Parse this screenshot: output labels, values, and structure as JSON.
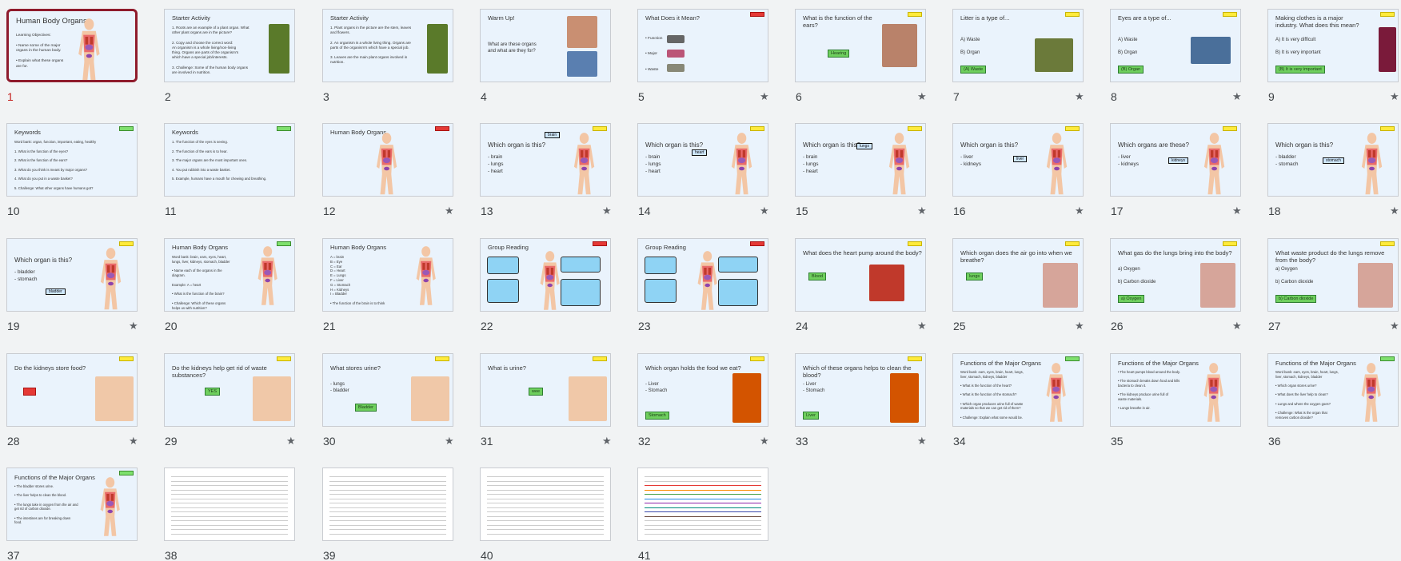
{
  "slides": [
    {
      "n": "1",
      "title": "Human Body Organs",
      "text": "Learning Objectives:\n\n• Name some of the major\n  organs in the human body.\n\n• Explain what these organs\n  are for.",
      "star": false,
      "selected": true
    },
    {
      "n": "2",
      "title": "Starter Activity",
      "text": "1. Roots are an example of a plant organ. What\n    other plant organs are in the picture?\n\n2. Copy and choose the correct word:\n    An organism is a whole living/non-living\n    thing. Organs are parts of the organism's\n    which have a special job/interests.\n\n3. Challenge: Some of the human body organs\n    are involved in nutrition.",
      "star": false
    },
    {
      "n": "3",
      "title": "Starter Activity",
      "text": "1. Plant organs in the picture are the stem, leaves\n    and flowers.\n\n2. An organism is a whole living thing. Organs are\n    parts of the organism's which have a special job.\n\n3. Leaves are the main plant organs involved in\n    nutrition.",
      "star": false
    },
    {
      "n": "4",
      "title": "Warm Up!",
      "text": "What are these organs\nand what are they for?",
      "star": false
    },
    {
      "n": "5",
      "title": "What Does it Mean?",
      "text": "• Function\n\n\n• Major\n\n\n• Waste",
      "star": true
    },
    {
      "n": "6",
      "title": "What is the function of the\nears?",
      "btn": "Hearing",
      "star": true
    },
    {
      "n": "7",
      "title": "Litter is a type of...",
      "text": "A)  Waste\n\nB)  Organ",
      "btn": "(A) Waste",
      "star": true
    },
    {
      "n": "8",
      "title": "Eyes are a type of...",
      "text": "A)  Waste\n\nB)  Organ",
      "btn": "(B) Organ",
      "star": true
    },
    {
      "n": "9",
      "title": "Making clothes is a major\nindustry. What does this mean?",
      "text": "A)  It is very difficult\n\nB)  It is very important",
      "btn": "(B) It is very important",
      "star": true
    },
    {
      "n": "10",
      "title": "Keywords",
      "text": "Word bank: organ, function, important, eating, healthy\n\n1. What is the function of the eyes?\n\n2. What is the function of the ears?\n\n3. What do you think is meant by major organs?\n\n4. What do you put in a waste basket?\n\n5. Challenge: What other organs have humans got?",
      "star": false
    },
    {
      "n": "11",
      "title": "Keywords",
      "text": "1.  The function of the eyes is seeing.\n\n2.  The function of the ears is to hear.\n\n3.  The major organs are the most important ones.\n\n4.  You put rubbish into a waste basket.\n\n5.  Example, humans have a mouth for chewing and breathing.",
      "star": false
    },
    {
      "n": "12",
      "title": "Human Body Organs",
      "star": true
    },
    {
      "n": "13",
      "title": "Which organ is this?",
      "text": "- brain\n- lungs\n- heart",
      "label": "brain",
      "star": true
    },
    {
      "n": "14",
      "title": "Which organ is this?",
      "text": "- brain\n- lungs\n- heart",
      "label": "heart",
      "star": true
    },
    {
      "n": "15",
      "title": "Which organ is this?",
      "text": "- brain\n- lungs\n- heart",
      "label": "lungs",
      "star": true
    },
    {
      "n": "16",
      "title": "Which organ is this?",
      "text": "- liver\n- kidneys",
      "label": "liver",
      "star": true
    },
    {
      "n": "17",
      "title": "Which organs are these?",
      "text": "- liver\n- kidneys",
      "label": "kidneys",
      "star": true
    },
    {
      "n": "18",
      "title": "Which organ is this?",
      "text": "- bladder\n- stomach",
      "label": "stomach",
      "star": true
    },
    {
      "n": "19",
      "title": "Which organ is this?",
      "text": "- bladder\n- stomach",
      "label": "bladder",
      "star": true
    },
    {
      "n": "20",
      "title": "Human Body Organs",
      "text": "Word bank: brain, ears, eyes, heart,\nlungs, liver, kidneys, stomach, bladder\n\n• Name each of the organs in the\n   diagram.\n\n   Example: A = heart\n\n• What is the function of the brain?\n\n• Challenge: Which of these organs\n   helps us with nutrition?",
      "star": false
    },
    {
      "n": "21",
      "title": "Human Body Organs",
      "text": "A = brain\nB = Eye\nC = Ear\nD = Heart\nE = Lungs\nF = Liver\nG = Stomach\nH = Kidneys\nI = Bladder\n\n• The function of the brain is to think\n\n• The stomach helps us with nutrition.",
      "star": false
    },
    {
      "n": "22",
      "title": "Group Reading",
      "star": false
    },
    {
      "n": "23",
      "title": "Group Reading",
      "star": false
    },
    {
      "n": "24",
      "title": "What does the heart pump around the body?",
      "btn": "Blood",
      "star": true
    },
    {
      "n": "25",
      "title": "Which organ does the air go into when we\nbreathe?",
      "btn": "lungs",
      "star": true
    },
    {
      "n": "26",
      "title": "What gas do the lungs bring into the body?",
      "text": "a) Oxygen\n\nb) Carbon dioxide",
      "btn": "a) Oxygen",
      "star": true
    },
    {
      "n": "27",
      "title": "What waste product do the lungs remove\nfrom the body?",
      "text": "a) Oxygen\n\nb) Carbon dioxide",
      "btn": "b) Carbon dioxide",
      "star": true
    },
    {
      "n": "28",
      "title": "Do the kidneys store food?",
      "btn": "NO",
      "star": true
    },
    {
      "n": "29",
      "title": "Do the kidneys help get rid of waste\nsubstances?",
      "btn": "YES",
      "star": true
    },
    {
      "n": "30",
      "title": "What stores urine?",
      "text": "- lungs\n- bladder",
      "btn": "Bladder",
      "star": true
    },
    {
      "n": "31",
      "title": "What is urine?",
      "btn": "wee",
      "star": true
    },
    {
      "n": "32",
      "title": "Which organ holds the food we eat?",
      "text": "-  Liver\n-  Stomach",
      "btn": "Stomach",
      "star": true
    },
    {
      "n": "33",
      "title": "Which of these organs helps to clean the\nblood?",
      "text": "-  Liver\n-  Stomach",
      "btn": "Liver",
      "star": true
    },
    {
      "n": "34",
      "title": "Functions of the Major Organs",
      "text": "Word bank: ears, eyes, brain, heart, lungs,\nliver, stomach, kidneys, bladder\n\n• What is the function of the heart?\n\n• What is the function of the stomach?\n\n• Which organ produces urine full of waste\n  materials so that we can get rid of them?\n\n• Challenge: Explain what some would be.",
      "star": false
    },
    {
      "n": "35",
      "title": "Functions of the Major Organs",
      "text": "• The heart pumps blood around the body.\n\n• The stomach breaks down food and kills\n  bacteria to clean it.\n\n• The kidneys produce urine full of\n  waste materials.\n\n• Lungs breathe in air.",
      "star": false
    },
    {
      "n": "36",
      "title": "Functions of the Major Organs",
      "text": "Word bank: ears, eyes, brain, heart, lungs,\nliver, stomach, kidneys, bladder\n\n• Which organ stores urine?\n\n• What does the liver help to clean?\n\n• Lungs and where the oxygen goes?\n\n• Challenge: What is the organ that\n  removes carbon dioxide?",
      "star": false
    },
    {
      "n": "37",
      "title": "Functions of the Major Organs",
      "text": "• The bladder stores urine.\n\n• The liver helps to clean the blood.\n\n• The lungs take in oxygen from the air and\n  get rid of carbon dioxide.\n\n• The intestines are for breaking down\n  food.",
      "star": false
    },
    {
      "n": "38",
      "title": "",
      "star": false
    },
    {
      "n": "39",
      "title": "",
      "star": false
    },
    {
      "n": "40",
      "title": "",
      "star": false
    },
    {
      "n": "41",
      "title": "",
      "star": false
    }
  ]
}
